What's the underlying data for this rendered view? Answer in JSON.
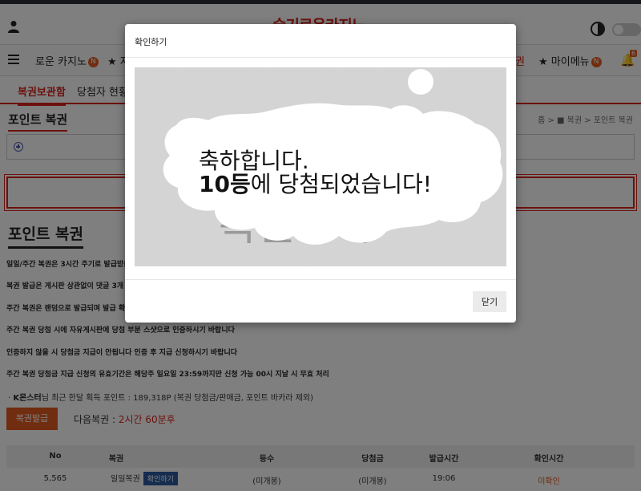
{
  "header": {
    "logo": "슬기로운카지노"
  },
  "nav": {
    "items": [
      "로운 카지노",
      "★ 저",
      "★ 마이메뉴"
    ],
    "right_item": "권",
    "badge": "N",
    "bell_count": "6"
  },
  "subnav": {
    "items": [
      "복권보관함",
      "당첨자 현황"
    ]
  },
  "page": {
    "title": "포인트 복권",
    "breadcrumb": "홈 > ■ 복권 > 포인트 복권"
  },
  "section": {
    "title": "포인트 복권",
    "info": [
      "일일/주간 복권은 3시간 주기로 발급받을",
      "복권 발급은 게시판 상관없이 댓글 3개 이",
      "주간 복권은 랜덤으로 발급되며 발급 확률",
      "주간 복권 당첨 시에 자유게시판에 당첨 부분 스샷으로 인증하시기 바랍니다",
      "인증하지 않을 시 당첨금 지급이 안됩니다 인증 후 지급 신청하시기 바랍니다",
      "주간 복권 당첨금 지급 신청의 유효기간은 해당주 일요일 23:59까지만 신청 가능 00시 지날 시 무효 처리"
    ],
    "points_user": "K몬스터",
    "points_text": "님 최근 한달 획득 포인트 : 189,318P (복권 당첨금/판매금, 포인트 바카라 제외)",
    "points_prefix": "· ",
    "issue_button": "복권발급",
    "next_label": "다음복권 : ",
    "next_value": "2시간 60분후"
  },
  "table": {
    "headers": [
      "No",
      "복권",
      "등수",
      "당첨금",
      "발급시간",
      "확인시간"
    ],
    "rows": [
      {
        "no": "5,565",
        "type": "일일복권",
        "action": "확인하기",
        "rank": "(미개봉)",
        "prize": "(미개봉)",
        "issued": "19:06",
        "checked": "미확인"
      }
    ]
  },
  "modal": {
    "title": "확인하기",
    "line1": "축하합니다.",
    "line2_bold": "10등",
    "line2_rest": "에 당첨되었습니다!",
    "scratch_bg": "복권하기",
    "close_label": "닫기"
  }
}
